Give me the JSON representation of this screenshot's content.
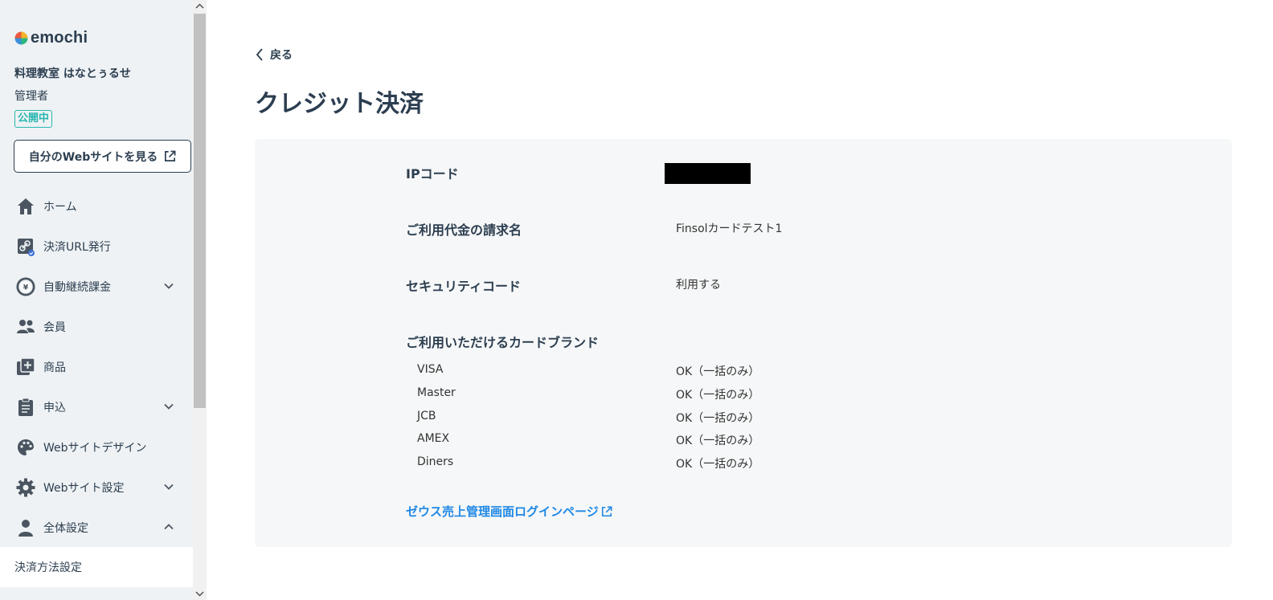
{
  "sidebar": {
    "logo_text": "emochi",
    "shop_name": "料理教室 はなとぅるせ",
    "role": "管理者",
    "status_badge": "公開中",
    "site_button": "自分のWebサイトを見る",
    "nav_items": [
      {
        "label": "ホーム",
        "icon": "home-icon"
      },
      {
        "label": "決済URL発行",
        "icon": "link-icon"
      },
      {
        "label": "自動継続課金",
        "icon": "yen-cycle-icon"
      },
      {
        "label": "会員",
        "icon": "members-icon"
      },
      {
        "label": "商品",
        "icon": "add-product-icon"
      },
      {
        "label": "申込",
        "icon": "clipboard-icon"
      },
      {
        "label": "Webサイトデザイン",
        "icon": "palette-icon"
      },
      {
        "label": "Webサイト設定",
        "icon": "gear-icon"
      },
      {
        "label": "全体設定",
        "icon": "person-icon"
      }
    ],
    "sub_item": "決済方法設定"
  },
  "main": {
    "back_label": "戻る",
    "title": "クレジット決済",
    "rows": [
      {
        "label": "IPコード",
        "value": ""
      },
      {
        "label": "ご利用代金の請求名",
        "value": "Finsolカードテスト1"
      },
      {
        "label": "セキュリティコード",
        "value": "利用する"
      },
      {
        "label": "ご利用いただけるカードブランド",
        "value": ""
      }
    ],
    "brands": [
      {
        "name": "VISA",
        "status": "OK（一括のみ）"
      },
      {
        "name": "Master",
        "status": "OK（一括のみ）"
      },
      {
        "name": "JCB",
        "status": "OK（一括のみ）"
      },
      {
        "name": "AMEX",
        "status": "OK（一括のみ）"
      },
      {
        "name": "Diners",
        "status": "OK（一括のみ）"
      }
    ],
    "zeus_link": "ゼウス売上管理画面ログインページ"
  },
  "colors": {
    "accent_teal": "#29b6b0",
    "link_blue": "#1e88e5",
    "text_dark": "#2c3e50",
    "sidebar_bg": "#eef2f4",
    "card_bg": "#f6f7f8"
  }
}
